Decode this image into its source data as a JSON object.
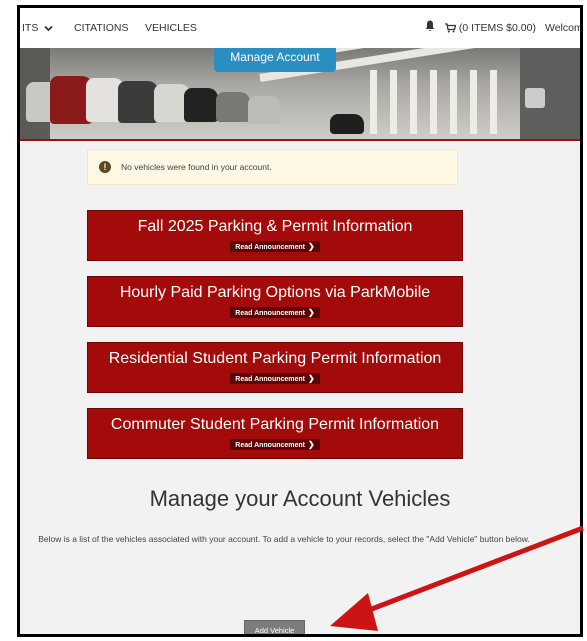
{
  "nav": {
    "items": [
      "ITS",
      "CITATIONS",
      "VEHICLES"
    ],
    "cart": "(0 ITEMS $0.00)",
    "welcome": "Welcome"
  },
  "hero": {
    "manage_button": "Manage Account"
  },
  "alert": {
    "message": "No vehicles were found in your account."
  },
  "announcements": [
    {
      "title": "Fall 2025 Parking & Permit Information",
      "link": "Read Announcement"
    },
    {
      "title": "Hourly Paid Parking Options via ParkMobile",
      "link": "Read Announcement"
    },
    {
      "title": "Residential Student Parking Permit Information",
      "link": "Read Announcement"
    },
    {
      "title": "Commuter Student Parking Permit Information",
      "link": "Read Announcement"
    }
  ],
  "vehicles": {
    "heading": "Manage your Account Vehicles",
    "description": "Below is a list of the vehicles associated with your account. To add a vehicle to your records, select the \"Add Vehicle\" button below.",
    "add_button": "Add Vehicle"
  },
  "colors": {
    "banner_red": "#a30b0b",
    "arrow_red": "#cc1414",
    "manage_blue": "#2a8ec0"
  },
  "icons": [
    "chevron-down-icon",
    "bell-icon",
    "cart-icon",
    "exclamation-icon",
    "chevron-right-icon"
  ]
}
